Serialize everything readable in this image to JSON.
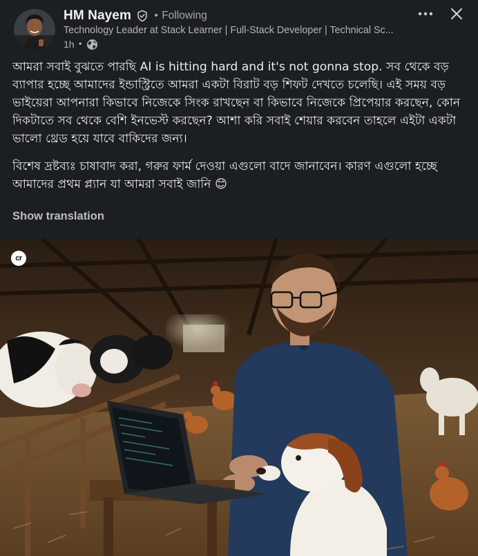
{
  "author": {
    "name": "HM Nayem",
    "follow_status": "Following",
    "headline": "Technology Leader at Stack Learner | Full-Stack Developer | Technical Sc...",
    "time": "1h"
  },
  "post": {
    "paragraphs": [
      "আমরা সবাই বুঝতে পারছি AI is hitting hard and it's not gonna stop. সব থেকে বড় ব্যাপার হচ্ছে আমাদের ইন্ডাস্ট্রিতে আমরা একটা বিরাট বড় শিফট দেখতে চলেছি। এই সময় বড় ভাইয়েরা আপনারা কিভাবে নিজেকে সিংক রাখছেন বা কিভাবে নিজেকে প্রিপেয়ার করছেন, কোন দিকটাতে সব থেকে বেশি ইনভেস্ট করছেন? আশা করি সবাই শেয়ার করবেন তাহলে এইটা একটা ভালো থ্রেড হয়ে যাবে বাকিদের জন্য।",
      "বিশেষ দ্রষ্টব্যঃ চাষাবাদ করা, গরুর ফার্ম দেওয়া এগুলো বাদে জানাবেন। কারণ এগুলো হচ্ছে আমাদের প্রথম প্ল্যান যা আমরা সবাই জানি 😊"
    ],
    "show_translation": "Show translation",
    "image_badge": "cr"
  },
  "icons": {
    "verified": "verified-shield-icon",
    "globe": "globe-icon",
    "more": "more-options-icon",
    "close": "close-icon"
  },
  "colors": {
    "background": "#1b1f23",
    "primary_text": "#ececec",
    "secondary_text": "#b5b5b5"
  }
}
